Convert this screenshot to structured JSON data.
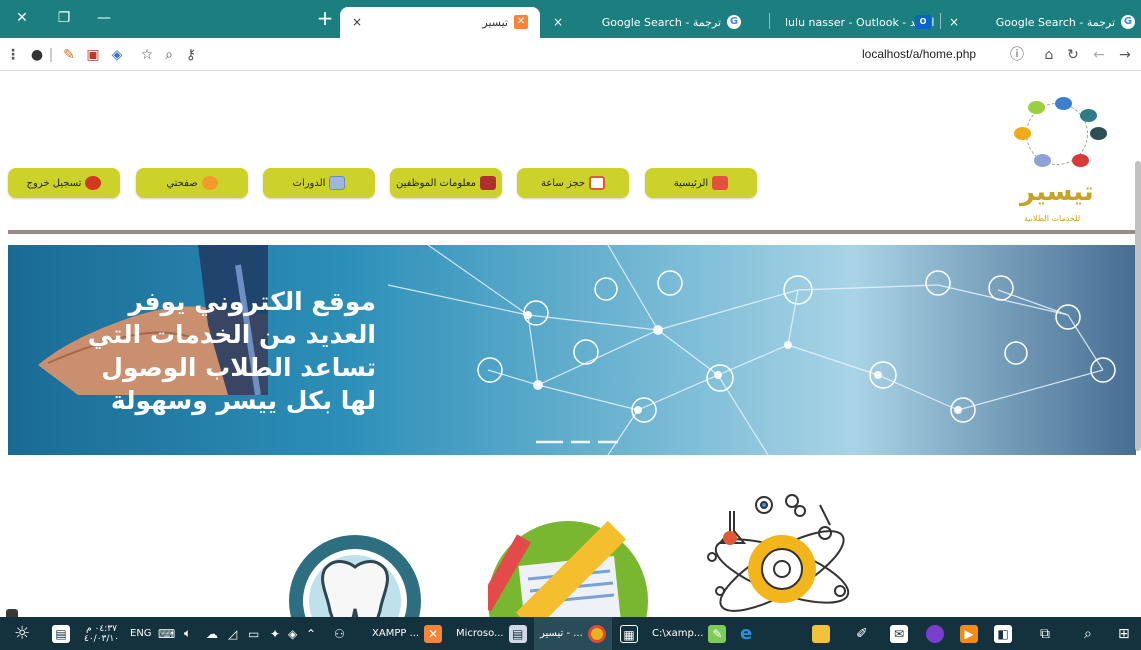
{
  "browser": {
    "tabs": [
      {
        "title": "تيسير",
        "favicon": "xampp-icon",
        "active": true
      },
      {
        "title": "Google Search - ترجمة",
        "favicon": "google-icon",
        "active": false
      },
      {
        "title": "lulu nasser - Outlook - البريد",
        "favicon": "outlook-icon",
        "active": false
      },
      {
        "title": "Google Search - ترجمة",
        "favicon": "google-icon",
        "active": false
      }
    ],
    "new_tab": "+",
    "close": "×",
    "url": "localhost/a/home.php"
  },
  "site": {
    "logo_name": "تيسير",
    "logo_sub": "للخدمات الطلابية",
    "nav": [
      {
        "label": "الرئيسية",
        "icon": "home-icon",
        "color": "#e24b4b"
      },
      {
        "label": "حجز ساعة",
        "icon": "calendar-icon",
        "color": "#e05a3a"
      },
      {
        "label": "معلومات الموظفين",
        "icon": "briefcase-icon",
        "color": "#b03030"
      },
      {
        "label": "الدورات",
        "icon": "card-icon",
        "color": "#6a8ac6"
      },
      {
        "label": "صفحتي",
        "icon": "pencil-icon",
        "color": "#f29a2a"
      },
      {
        "label": "تسجيل خروج",
        "icon": "power-icon",
        "color": "#d13a1e"
      }
    ],
    "banner_lines": [
      "موقع الكتروني يوفر",
      "العديد من الخدمات التي",
      "تساعد الطلاب الوصول",
      "لها بكل ييسر وسهولة"
    ]
  },
  "taskbar": {
    "time": "٠٤:٣٧ م",
    "date": "٤٠/٠٣/١٠",
    "lang": "ENG",
    "items": [
      {
        "label": "XAMPP ...",
        "icon": "xampp-icon"
      },
      {
        "label": "Microso...",
        "icon": "word-icon"
      },
      {
        "label": "تيسير - ...",
        "icon": "chrome-icon"
      },
      {
        "label": "C:\\xamp...",
        "icon": "notepad-icon"
      }
    ]
  }
}
